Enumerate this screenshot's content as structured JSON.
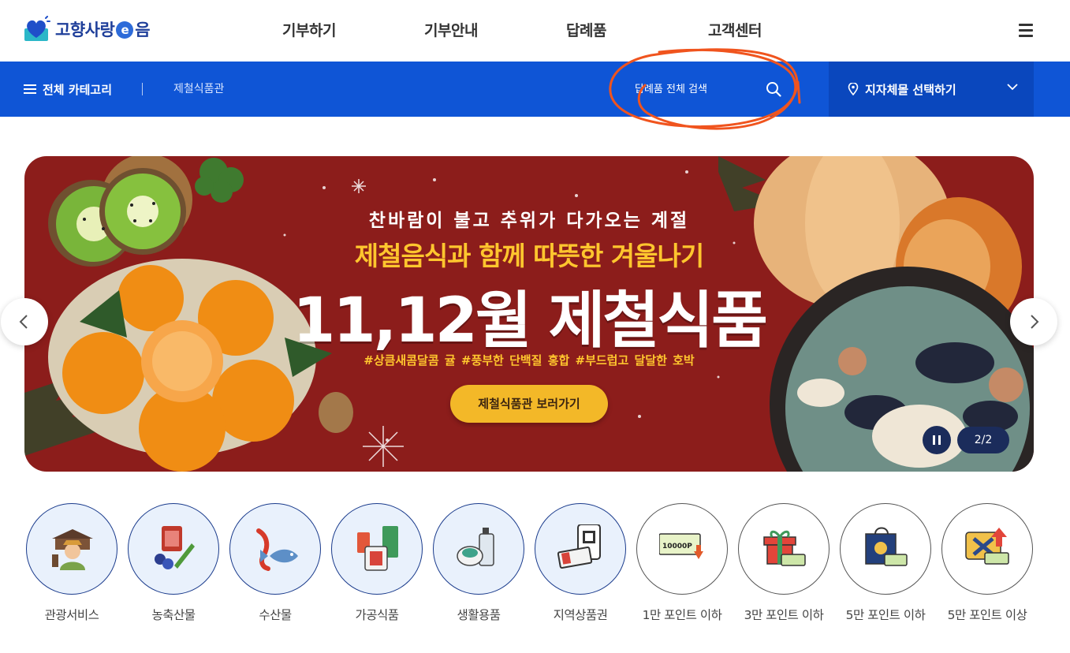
{
  "header": {
    "logo": "고향사랑e음",
    "logo_parts": {
      "before": "고향사랑",
      "e": "e",
      "after": "음"
    },
    "nav": [
      "기부하기",
      "기부안내",
      "답례품",
      "고객센터"
    ]
  },
  "subbar": {
    "category_button": "전체 카테고리",
    "season_link": "제철식품관",
    "search_placeholder": "답례품 전체 검색",
    "region_select": "지자체몰 선택하기"
  },
  "banner": {
    "subtitle": "찬바람이 불고 추위가 다가오는 계절",
    "tagline": "제철음식과 함께 따뜻한 겨울나기",
    "title": "11,12월 제철식품",
    "hashtags": "#상큼새콤달콤 귤   #풍부한 단백질 홍합   #부드럽고 달달한 호박",
    "cta": "제철식품관 보러가기",
    "counter": "2/2"
  },
  "categories": [
    {
      "label": "관광서비스",
      "icon": "tourist-guide-icon"
    },
    {
      "label": "농축산물",
      "icon": "meat-vegetable-icon"
    },
    {
      "label": "수산물",
      "icon": "seafood-icon"
    },
    {
      "label": "가공식품",
      "icon": "processed-food-icon"
    },
    {
      "label": "생활용품",
      "icon": "household-goods-icon"
    },
    {
      "label": "지역상품권",
      "icon": "voucher-icon"
    },
    {
      "label": "1만 포인트 이하",
      "icon": "point-10000-icon"
    },
    {
      "label": "3만 포인트 이하",
      "icon": "gift-box-icon"
    },
    {
      "label": "5만 포인트 이하",
      "icon": "gift-bag-icon"
    },
    {
      "label": "5만 포인트 이상",
      "icon": "premium-gift-icon"
    }
  ],
  "icon_badge_text": "10000P",
  "colors": {
    "brand_blue": "#0f55d6",
    "banner_red": "#8c1d1b",
    "accent_yellow": "#ffc62e",
    "annotation": "#f0541e"
  }
}
